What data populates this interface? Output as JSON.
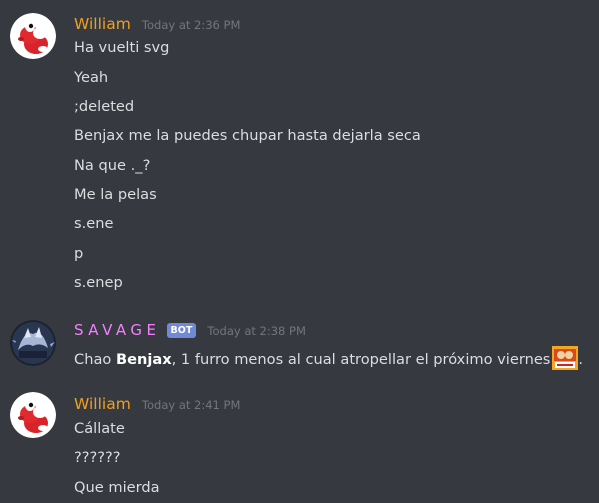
{
  "groups": [
    {
      "author": "William",
      "author_color": "#f0a020",
      "timestamp": "Today at 2:36 PM",
      "avatar": "yoshi-avatar",
      "messages": [
        "Ha vuelti svg",
        "Yeah",
        ";deleted",
        "Benjax me la puedes chupar hasta dejarla seca",
        "Na que ._?",
        "Me la pelas",
        "s.ene",
        "p",
        "s.enep"
      ]
    },
    {
      "author": "SAVAGE",
      "author_color": "#f47fff",
      "bot_tag": "BOT",
      "timestamp": "Today at 2:38 PM",
      "avatar": "savage-avatar",
      "message": {
        "before": "Chao ",
        "bold": "Benjax",
        "after": ", 1 furro menos al cual atropellar el próximo viernes",
        "end": "."
      }
    },
    {
      "author": "William",
      "author_color": "#f0a020",
      "timestamp": "Today at 2:41 PM",
      "avatar": "yoshi-avatar",
      "messages": [
        "Cállate",
        "??????",
        "Que mierda"
      ]
    }
  ]
}
